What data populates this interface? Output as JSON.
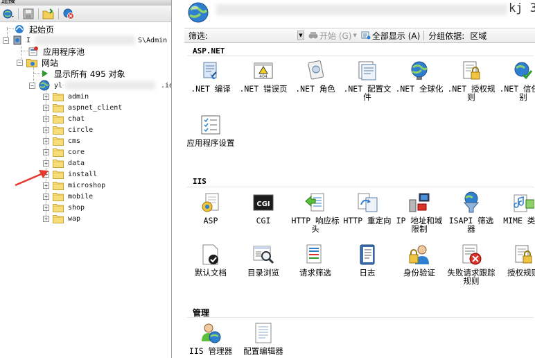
{
  "left_pane": {
    "title_fragment": "连接",
    "toolbar_icons": [
      "connect-icon",
      "save-icon",
      "open-folder-icon",
      "disconnect-icon"
    ],
    "tree": {
      "start_page": "起始页",
      "server_suffix": "S\\Admin",
      "server_prefix": "I",
      "app_pools": "应用程序池",
      "sites": "网站",
      "show_all": "显示所有 495 对象",
      "site_name_prefix": "yl",
      "site_name_suffix": ".id",
      "folders": [
        "admin",
        "aspnet_client",
        "chat",
        "circle",
        "cms",
        "core",
        "data",
        "install",
        "microshop",
        "mobile",
        "shop",
        "wap"
      ]
    }
  },
  "right_pane": {
    "header_title": "kj 3",
    "filter": {
      "label": "筛选:",
      "value": "",
      "start_label": "开始 (G)",
      "show_all_label": "全部显示 (A)",
      "group_by_label": "分组依据:",
      "group_by_value": "区域"
    },
    "sections": [
      {
        "name": "ASP.NET",
        "items": [
          {
            "label": ".NET 编译",
            "icon": "net-compile-icon"
          },
          {
            "label": ".NET 错误页",
            "icon": "net-error-pages-icon"
          },
          {
            "label": ".NET 角色",
            "icon": "net-roles-icon"
          },
          {
            "label": ".NET 配置文件",
            "icon": "net-profile-icon"
          },
          {
            "label": ".NET 全球化",
            "icon": "net-globalization-icon"
          },
          {
            "label": ".NET 授权规则",
            "icon": "net-authorization-icon"
          },
          {
            "label": ".NET 信任级别",
            "icon": "net-trust-levels-icon"
          },
          {
            "label": "应用程序设置",
            "icon": "app-settings-icon"
          }
        ]
      },
      {
        "name": "IIS",
        "items": [
          {
            "label": "ASP",
            "icon": "asp-icon"
          },
          {
            "label": "CGI",
            "icon": "cgi-icon"
          },
          {
            "label": "HTTP 响应标头",
            "icon": "http-headers-icon"
          },
          {
            "label": "HTTP 重定向",
            "icon": "http-redirect-icon"
          },
          {
            "label": "IP 地址和域限制",
            "icon": "ip-restrictions-icon"
          },
          {
            "label": "ISAPI 筛选器",
            "icon": "isapi-filters-icon"
          },
          {
            "label": "MIME 类型",
            "icon": "mime-types-icon"
          },
          {
            "label": "默认文档",
            "icon": "default-document-icon"
          },
          {
            "label": "目录浏览",
            "icon": "directory-browsing-icon"
          },
          {
            "label": "请求筛选",
            "icon": "request-filtering-icon"
          },
          {
            "label": "日志",
            "icon": "logging-icon"
          },
          {
            "label": "身份验证",
            "icon": "authentication-icon"
          },
          {
            "label": "失败请求跟踪规则",
            "icon": "failed-request-tracing-icon"
          },
          {
            "label": "授权规则",
            "icon": "authorization-rules-icon"
          }
        ]
      },
      {
        "name": "管理",
        "items": [
          {
            "label": "IIS 管理器",
            "icon": "iis-manager-permissions-icon"
          },
          {
            "label": "配置编辑器",
            "icon": "configuration-editor-icon"
          }
        ]
      }
    ]
  },
  "colors": {
    "annotation_arrow": "#e8372c",
    "folder": "#f2cf5a",
    "globe": "#2f7fd0"
  }
}
